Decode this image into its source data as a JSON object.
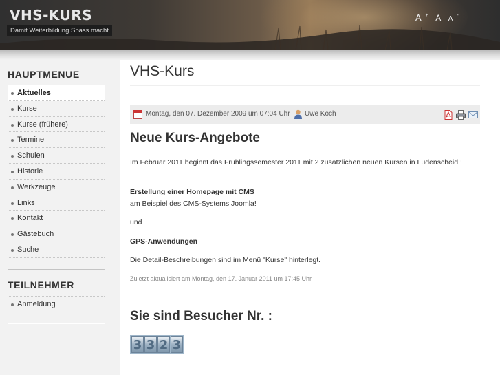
{
  "header": {
    "site_title": "VHS-KURS",
    "slogan": "Damit Weiterbildung Spass macht",
    "font_controls": {
      "larger": "A",
      "larger_sup": "+",
      "normal": "A",
      "smaller": "A",
      "smaller_sup": "-"
    }
  },
  "sidebar": {
    "main_menu_title": "HAUPTMENUE",
    "main_menu": [
      {
        "label": "Aktuelles",
        "active": true
      },
      {
        "label": "Kurse"
      },
      {
        "label": "Kurse (frühere)"
      },
      {
        "label": "Termine"
      },
      {
        "label": "Schulen"
      },
      {
        "label": "Historie"
      },
      {
        "label": "Werkzeuge"
      },
      {
        "label": "Links"
      },
      {
        "label": "Kontakt"
      },
      {
        "label": "Gästebuch"
      },
      {
        "label": "Suche"
      }
    ],
    "participant_menu_title": "TEILNEHMER",
    "participant_menu": [
      {
        "label": "Anmeldung"
      }
    ]
  },
  "main": {
    "page_heading": "VHS-Kurs",
    "meta": {
      "date": "Montag, den 07. Dezember 2009 um 07:04 Uhr",
      "author": "Uwe Koch",
      "actions": [
        "pdf-icon",
        "print-icon",
        "email-icon"
      ]
    },
    "article": {
      "title": "Neue Kurs-Angebote",
      "intro": "Im Februar 2011 beginnt das Frühlingssemester 2011 mit 2 zusätzlichen neuen Kursen in Lüdenscheid :",
      "course1_title": "Erstellung einer Homepage mit CMS",
      "course1_desc": "am Beispiel des CMS-Systems Joomla!",
      "and": "und",
      "course2_title": "GPS-Anwendungen",
      "details": "Die Detail-Beschreibungen sind im Menü \"Kurse\" hinterlegt.",
      "modified": "Zuletzt aktualisiert am Montag, den 17. Januar 2011 um 17:45 Uhr"
    },
    "visitor": {
      "title": "Sie sind Besucher Nr. :",
      "count_digits": [
        "3",
        "3",
        "2",
        "3"
      ]
    }
  },
  "colors": {
    "header_dark": "#303030",
    "sidebar_bg": "#f2f2f2",
    "meta_bar_bg": "#ececec",
    "counter_blue": "#9fb6c9"
  }
}
